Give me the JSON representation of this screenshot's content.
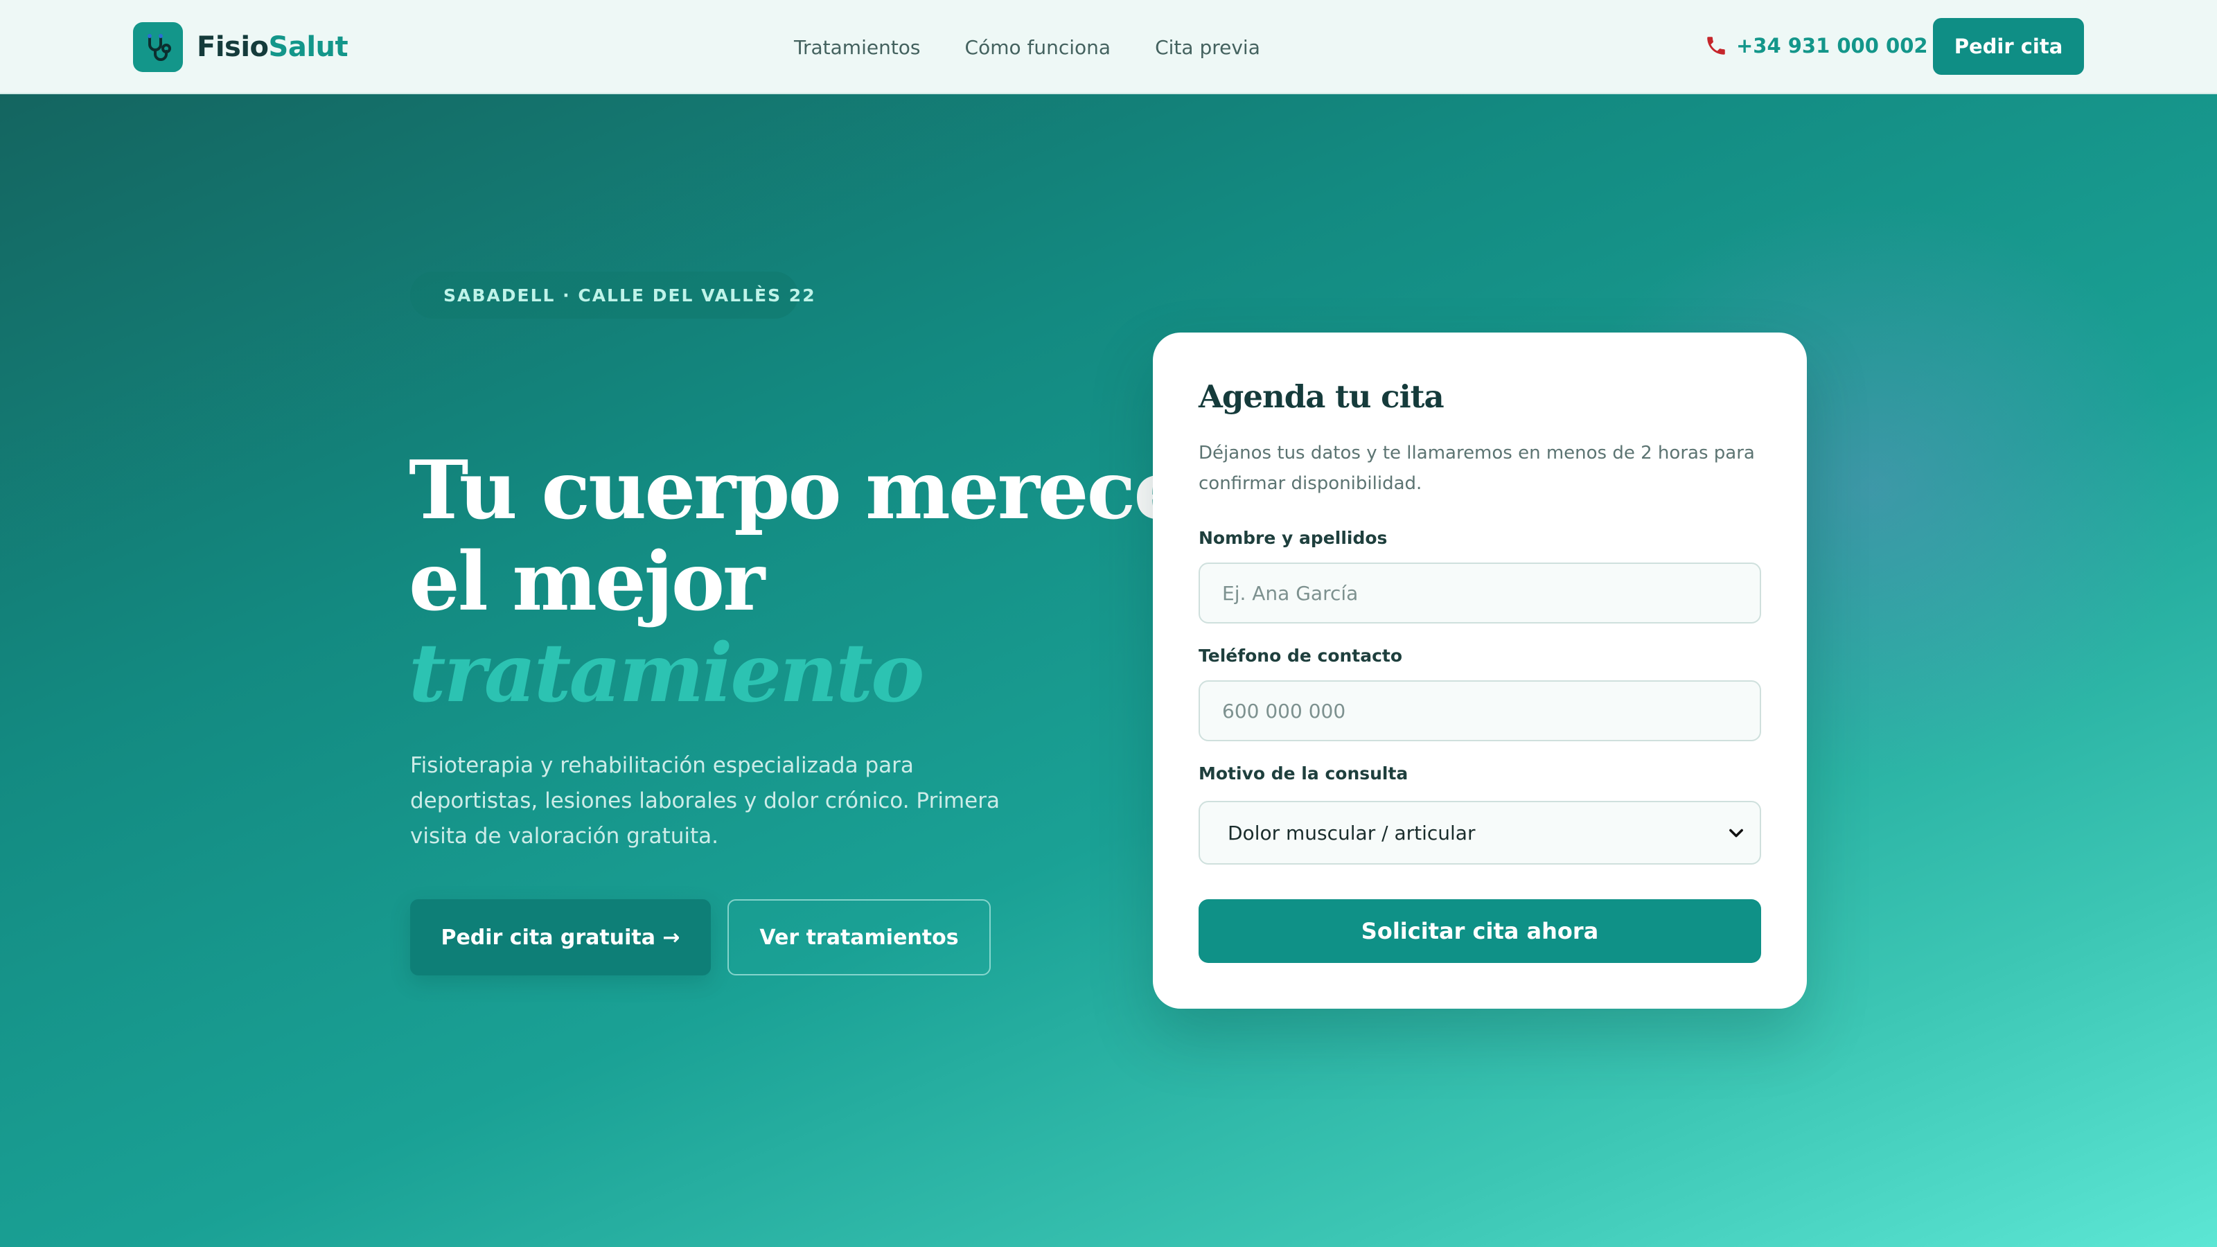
{
  "brand": {
    "name_part1": "Fisio",
    "name_part2": "Salut"
  },
  "nav": {
    "links": [
      {
        "label": "Tratamientos"
      },
      {
        "label": "Cómo funciona"
      },
      {
        "label": "Cita previa"
      }
    ],
    "phone": "+34 931 000 002",
    "cta_label": "Pedir cita"
  },
  "hero": {
    "location_badge": "SABADELL · CALLE DEL VALLÈS 22",
    "headline_line1": "Tu cuerpo merece",
    "headline_line2": "el mejor",
    "headline_accent": "tratamiento",
    "lead": "Fisioterapia y rehabilitación especializada para deportistas, lesiones laborales y dolor crónico. Primera visita de valoración gratuita.",
    "primary_cta": "Pedir cita gratuita →",
    "secondary_cta": "Ver tratamientos"
  },
  "form": {
    "title": "Agenda tu cita",
    "subtitle": "Déjanos tus datos y te llamaremos en menos de 2 horas para confirmar disponibilidad.",
    "name_label": "Nombre y apellidos",
    "name_placeholder": "Ej. Ana García",
    "phone_label": "Teléfono de contacto",
    "phone_placeholder": "600 000 000",
    "reason_label": "Motivo de la consulta",
    "reason_selected": "Dolor muscular / articular",
    "submit_label": "Solicitar cita ahora"
  },
  "colors": {
    "brand_teal": "#13968a",
    "brand_dark": "#153b3b",
    "accent_text": "#2cc3b2"
  }
}
